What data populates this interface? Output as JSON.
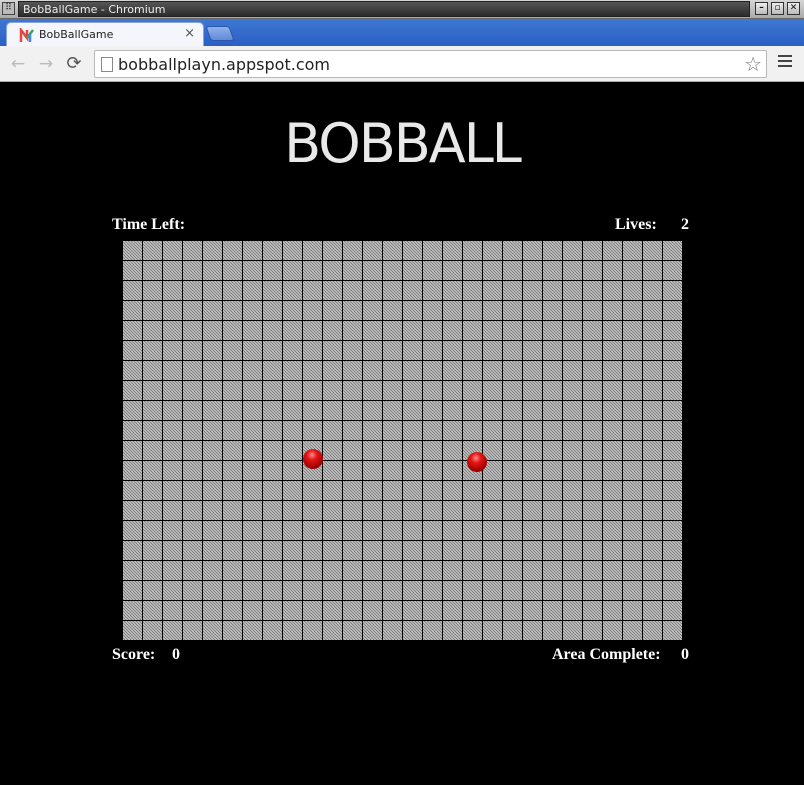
{
  "window": {
    "title": "BobBallGame - Chromium"
  },
  "tab": {
    "title": "BobBallGame",
    "close": "×"
  },
  "toolbar": {
    "url": "bobballplayn.appspot.com",
    "back": "←",
    "forward": "→",
    "reload": "⟳",
    "star": "☆"
  },
  "game": {
    "logo": "BOBBALL",
    "time_left_label": "Time Left:",
    "time_left_value": "",
    "lives_label": "Lives:",
    "lives_value": "2",
    "score_label": "Score:",
    "score_value": "0",
    "area_label": "Area Complete:",
    "area_value": "0",
    "ball_count": 2,
    "colors": {
      "ball": "#cc0000",
      "board": "#9a9a9a",
      "background": "#000000"
    }
  }
}
